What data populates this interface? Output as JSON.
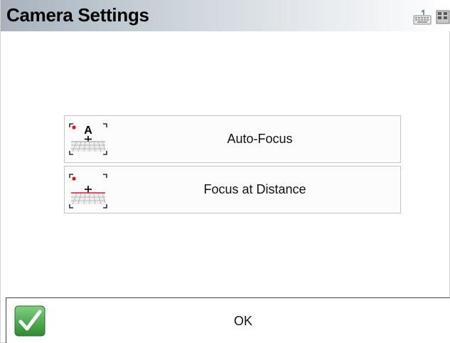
{
  "window": {
    "title": "Camera Settings"
  },
  "titlebar_icons": {
    "keyboard": "keyboard-icon",
    "status": "status-icon"
  },
  "options": [
    {
      "label": "Auto-Focus",
      "icon": "auto-focus-icon",
      "icon_letter": "A"
    },
    {
      "label": "Focus at Distance",
      "icon": "focus-distance-icon"
    }
  ],
  "footer": {
    "ok_label": "OK",
    "ok_icon": "checkmark-icon"
  },
  "colors": {
    "focus_dot": "#e81010",
    "focus_line": "#d02020",
    "check_green": "#3aa43a"
  }
}
